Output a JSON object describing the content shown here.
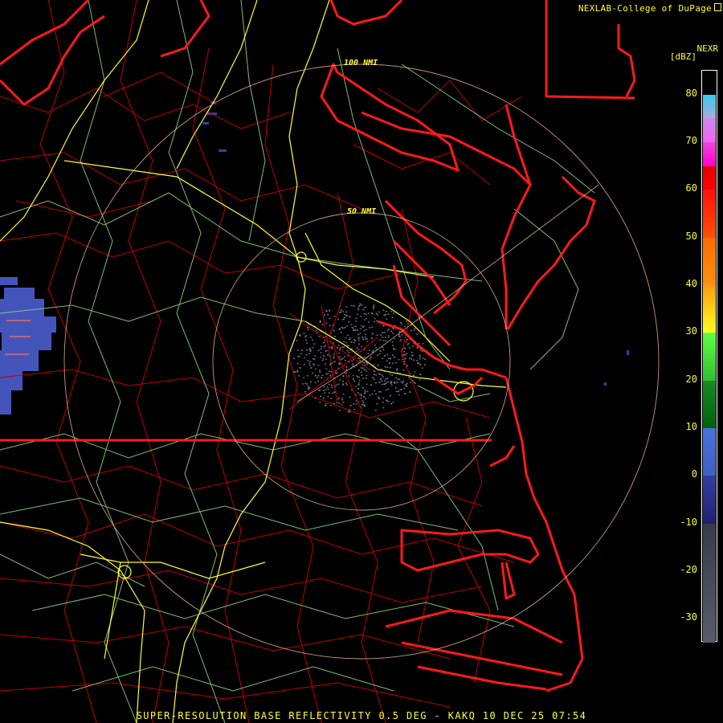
{
  "credit": {
    "text": "NEXLAB-College of DuPage",
    "icon": "external-link-icon"
  },
  "legend": {
    "product": "NEXR",
    "units": "[dBZ]",
    "ticks": [
      "80",
      "70",
      "60",
      "50",
      "40",
      "30",
      "20",
      "10",
      "0",
      "-10",
      "-20",
      "-30"
    ],
    "range_min": -35,
    "range_max": 85
  },
  "rings": {
    "inner": "50 NMI",
    "outer": "100 NMI"
  },
  "footer": "SUPER-RESOLUTION BASE REFLECTIVITY 0.5 DEG - KAKQ 10 DEC 25 07:54",
  "colors": {
    "state_border": "#ff0000",
    "county_border": "#cc0000",
    "highways": "#ffff33",
    "roads": "#99dd88",
    "range_ring": "#e8b098",
    "labels": "#ffff33"
  }
}
